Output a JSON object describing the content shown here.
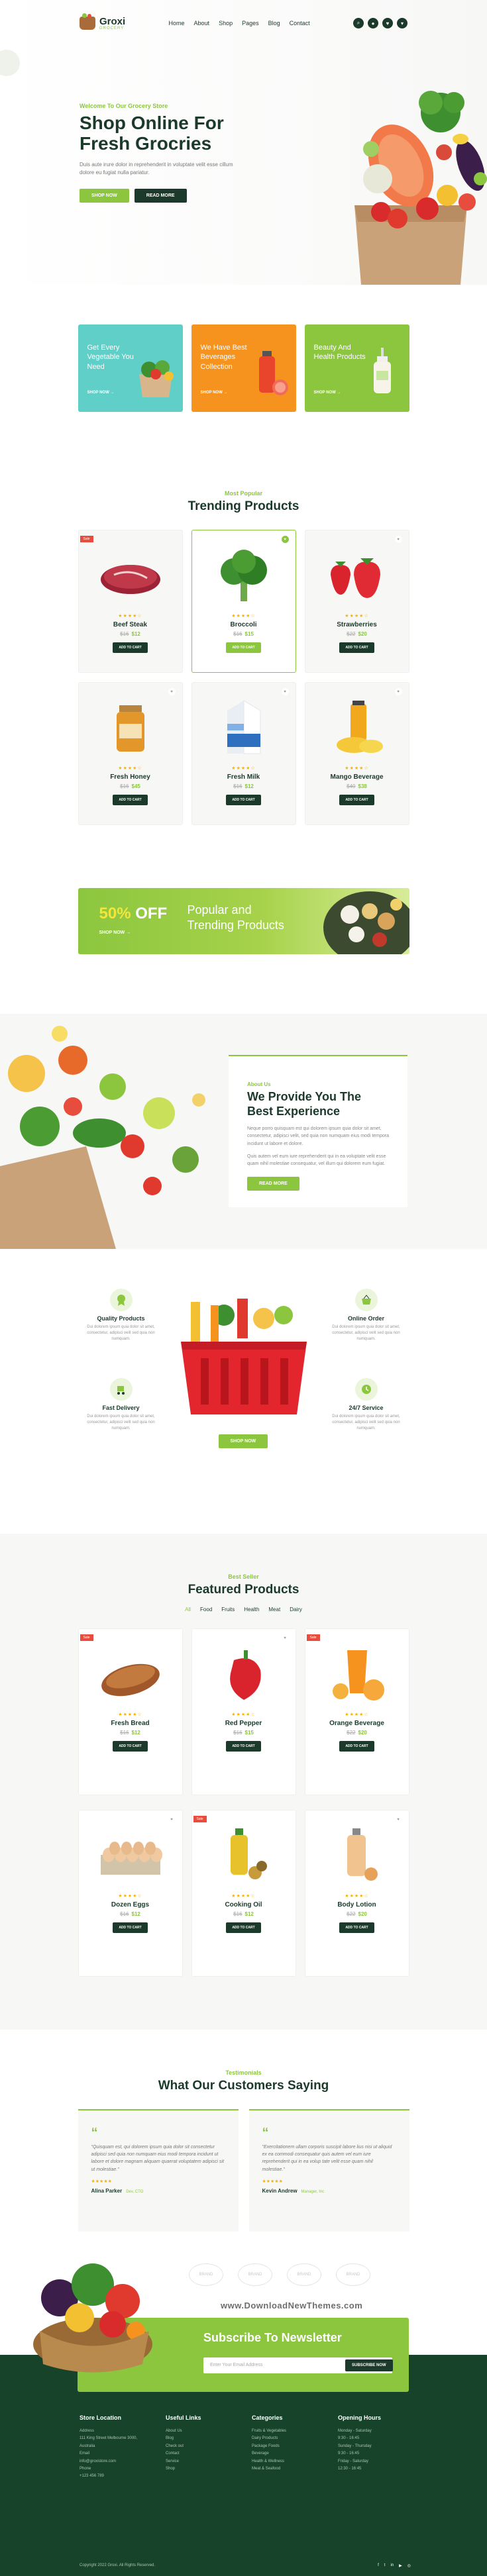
{
  "brand": {
    "name": "Groxi",
    "tagline": "GROCERY"
  },
  "nav": {
    "items": [
      "Home",
      "About",
      "Shop",
      "Pages",
      "Blog",
      "Contact"
    ]
  },
  "hero": {
    "kicker": "Welcome To Our Grocery Store",
    "title_line1": "Shop Online For",
    "title_line2": "Fresh Grocries",
    "desc": "Duis aute irure dolor in reprehenderit in voluptate velit esse cillum dolore eu fugiat nulla pariatur.",
    "btn_primary": "SHOP NOW",
    "btn_secondary": "READ MORE"
  },
  "promos": [
    {
      "text": "Get Every Vegetable You Need",
      "link": "SHOP NOW →",
      "color": "#5fcfc7"
    },
    {
      "text": "We Have Best Beverages Collection",
      "link": "SHOP NOW →",
      "color": "#f6921e"
    },
    {
      "text": "Beauty And Health Products",
      "link": "SHOP NOW →",
      "color": "#8cc63f"
    }
  ],
  "trending": {
    "kicker": "Most Popular",
    "title": "Trending Products",
    "add_label": "ADD TO CART",
    "sale_label": "Sale",
    "products": [
      {
        "name": "Beef Steak",
        "old": "$16",
        "new": "$12",
        "stars": "★★★★☆"
      },
      {
        "name": "Broccoli",
        "old": "$16",
        "new": "$15",
        "stars": "★★★★☆"
      },
      {
        "name": "Strawberries",
        "old": "$22",
        "new": "$20",
        "stars": "★★★★☆"
      },
      {
        "name": "Fresh Honey",
        "old": "$16",
        "new": "$45",
        "stars": "★★★★☆"
      },
      {
        "name": "Fresh Milk",
        "old": "$16",
        "new": "$12",
        "stars": "★★★★☆"
      },
      {
        "name": "Mango Beverage",
        "old": "$40",
        "new": "$38",
        "stars": "★★★★☆"
      }
    ]
  },
  "banner": {
    "percent": "50%",
    "off": "OFF",
    "shop": "SHOP NOW →",
    "title_line1": "Popular and",
    "title_line2": "Trending Products"
  },
  "about": {
    "kicker": "About Us",
    "title_line1": "We Provide You The",
    "title_line2": "Best Experience",
    "p1": "Neque porro quisquam est qui dolorem ipsum quia dolor sit amet, consectetur, adipisci velit, sed quia non numquam eius modi tempora incidunt ut labore et dolore.",
    "p2": "Quis autem vel eum iure reprehenderit qui in ea voluptate velit esse quam nihil molestiae consequatur, vel illum qui dolorem eum fugiat.",
    "btn": "READ MORE"
  },
  "features": {
    "items": [
      {
        "title": "Quality Products",
        "desc": "Dui dolorem ipsum quia dolor sit amet, consectetur, adipisci velit sed quia non numquam."
      },
      {
        "title": "Online Order",
        "desc": "Dui dolorem ipsum quia dolor sit amet, consectetur, adipisci velit sed quia non numquam."
      },
      {
        "title": "Fast Delivery",
        "desc": "Dui dolorem ipsum quia dolor sit amet, consectetur, adipisci velit sed quia non numquam."
      },
      {
        "title": "24/7 Service",
        "desc": "Dui dolorem ipsum quia dolor sit amet, consectetur, adipisci velit sed quia non numquam."
      }
    ],
    "btn": "SHOP NOW"
  },
  "featured": {
    "kicker": "Best Seller",
    "title": "Featured Products",
    "filters": [
      "All",
      "Food",
      "Fruits",
      "Health",
      "Meat",
      "Dairy"
    ],
    "add_label": "ADD TO CART",
    "sale_label": "Sale",
    "products": [
      {
        "name": "Fresh Bread",
        "old": "$16",
        "new": "$12",
        "stars": "★★★★☆"
      },
      {
        "name": "Red Pepper",
        "old": "$16",
        "new": "$15",
        "stars": "★★★★☆"
      },
      {
        "name": "Orange Beverage",
        "old": "$22",
        "new": "$20",
        "stars": "★★★★☆"
      },
      {
        "name": "Dozen Eggs",
        "old": "$16",
        "new": "$12",
        "stars": "★★★★☆"
      },
      {
        "name": "Cooking Oil",
        "old": "$16",
        "new": "$12",
        "stars": "★★★★☆"
      },
      {
        "name": "Body Lotion",
        "old": "$22",
        "new": "$20",
        "stars": "★★★★☆"
      }
    ]
  },
  "testimonials": {
    "kicker": "Testimonials",
    "title": "What Our Customers Saying",
    "items": [
      {
        "text": "\"Quisquam est, qui dolorem ipsum quia dolor sit consectetur adipisci sed quia non numquam eius modi tempora incidunt ut labore et dolore magnam aliquam quaerat voluptatem adipisci sit ut molestiae.\"",
        "name": "Alina Parker",
        "role": "Dev, CTO",
        "stars": "★★★★★"
      },
      {
        "text": "\"Exercitationem ullam corporis suscipit labore lius nisi ut aliquid ex ea commodi consequatur quis autem vel eum iure reprehenderit qui in ea volup tate velit esse quam nihil molestiae.\"",
        "name": "Kevin Andrew",
        "role": "Manager, Inc",
        "stars": "★★★★★"
      }
    ]
  },
  "brands": [
    "BRAND",
    "BRAND",
    "BRAND",
    "BRAND",
    "BRAND",
    "BRAND"
  ],
  "watermark": "www.DownloadNewThemes.com",
  "newsletter": {
    "title": "Subscribe To Newsletter",
    "placeholder": "Enter Your Email Address",
    "btn": "SUBSCRIBE NOW"
  },
  "footer": {
    "col1": {
      "title": "Store Location",
      "lines": [
        "Address",
        "111 King Street Melbourne 3000, Australia",
        "Email",
        "info@groxistore.com",
        "Phone",
        "+123 456 789"
      ]
    },
    "col2": {
      "title": "Useful Links",
      "lines": [
        "About Us",
        "Blog",
        "Check out",
        "Contact",
        "Service",
        "Shop"
      ]
    },
    "col3": {
      "title": "Categories",
      "lines": [
        "Fruits & Vegetables",
        "Dairy Products",
        "Package Foods",
        "Beverage",
        "Health & Wellness",
        "Meat & Seafood"
      ]
    },
    "col4": {
      "title": "Opening Hours",
      "lines": [
        "Monday - Saturday",
        "9:30 - 16:45",
        "Sunday - Thursday",
        "9:30 - 16:45",
        "Friday - Saturday",
        "12:30 - 16:45"
      ]
    },
    "copyright": "Copyright 2022 Groxi. All Rights Reserved."
  }
}
